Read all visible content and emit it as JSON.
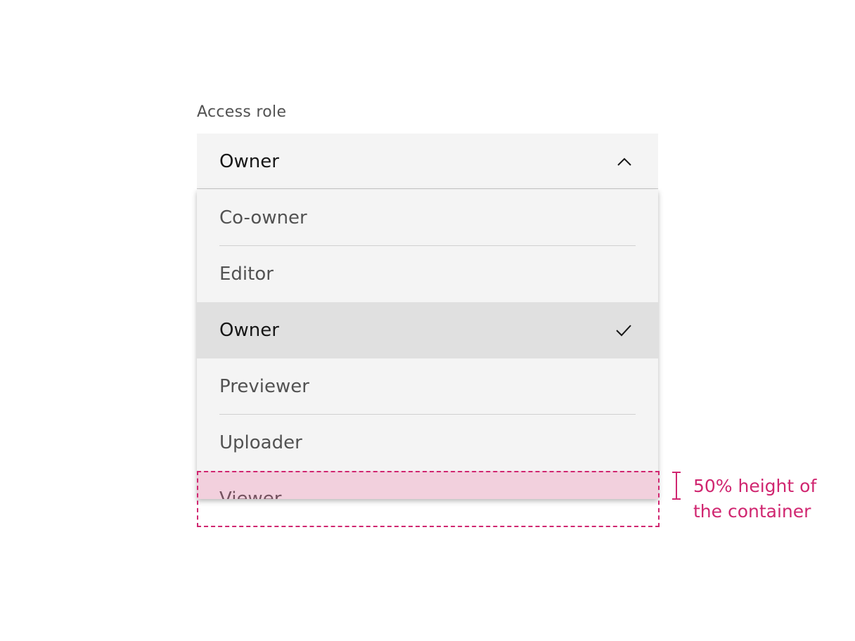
{
  "field": {
    "label": "Access role",
    "value": "Owner",
    "expanded_icon": "chevron-up-icon"
  },
  "menu": {
    "items": [
      {
        "label": "Co-owner",
        "selected": false
      },
      {
        "label": "Editor",
        "selected": false
      },
      {
        "label": "Owner",
        "selected": true
      },
      {
        "label": "Previewer",
        "selected": false
      },
      {
        "label": "Uploader",
        "selected": false
      },
      {
        "label": "Viewer",
        "selected": false
      }
    ],
    "selected_icon": "checkmark-icon"
  },
  "annotation": {
    "line1": "50% height of",
    "line2": "the container"
  },
  "colors": {
    "field_background": "#f4f4f4",
    "selected_background": "#e0e0e0",
    "annotation_accent": "#d02670",
    "text_primary": "#161616",
    "text_secondary": "#525252"
  }
}
